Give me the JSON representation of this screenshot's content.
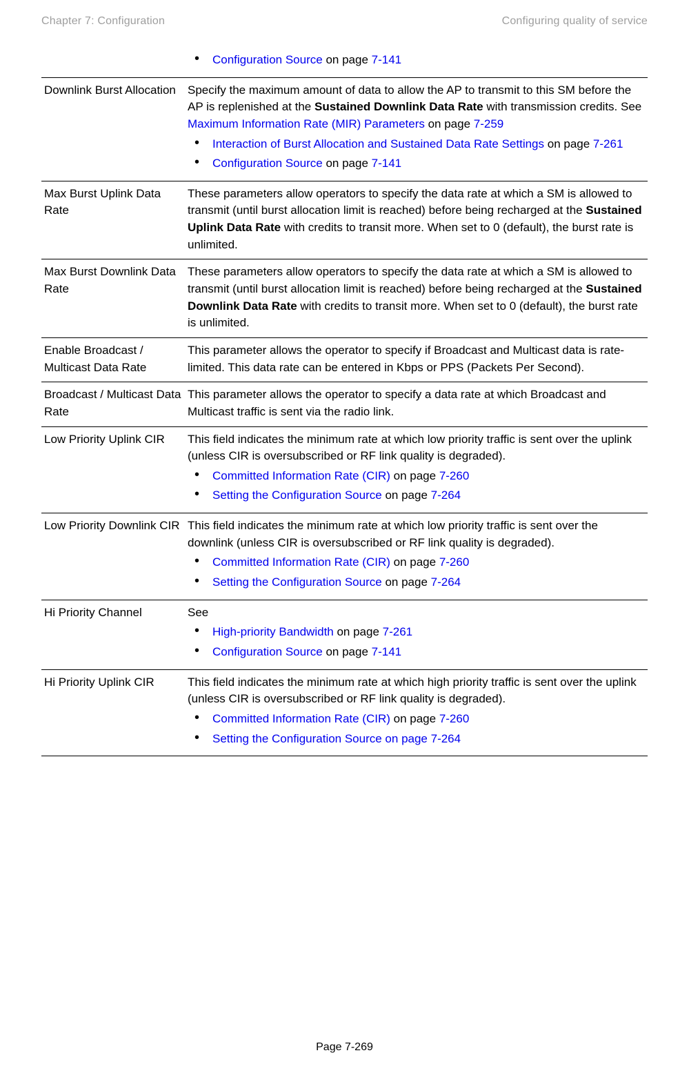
{
  "header": {
    "left": "Chapter 7:  Configuration",
    "right": "Configuring quality of service"
  },
  "footer": {
    "page": "Page 7-269"
  },
  "row0": {
    "b1_link": "Configuration Source",
    "b1_mid": " on page ",
    "b1_page": "7-141"
  },
  "row1": {
    "attr": "Downlink Burst Allocation",
    "p1a": "Specify the maximum amount of data to allow the AP to transmit to this SM before the AP is replenished at the ",
    "p1bold": "Sustained Downlink Data Rate",
    "p1b": " with transmission credits. See ",
    "p1link": "Maximum Information Rate (MIR) Parameters",
    "p1c": " on page ",
    "p1page": "7-259",
    "b1_link": "Interaction of Burst Allocation and Sustained Data Rate Settings",
    "b1_mid": " on page ",
    "b1_page": "7-261",
    "b2_link": "Configuration Source",
    "b2_mid": " on page ",
    "b2_page": "7-141"
  },
  "row2": {
    "attr": "Max Burst Uplink Data Rate",
    "p_a": "These parameters allow operators to specify the data rate at which a SM is allowed to transmit (until burst allocation limit is reached) before being recharged at the ",
    "p_bold": "Sustained Uplink Data Rate",
    "p_b": " with credits to transit more. When set to 0 (default), the burst rate is unlimited."
  },
  "row3": {
    "attr": "Max Burst Downlink Data Rate",
    "p_a": "These parameters allow operators to specify the data rate at which a SM is allowed to transmit (until burst allocation limit is reached) before being recharged at the ",
    "p_bold": "Sustained Downlink Data Rate",
    "p_b": " with credits to transit more. When set to 0 (default), the burst rate is unlimited."
  },
  "row4": {
    "attr": "Enable Broadcast / Multicast Data Rate",
    "p": "This parameter allows the operator to specify if Broadcast and Multicast data is rate-limited. This data rate can be entered in Kbps or PPS (Packets Per Second)."
  },
  "row5": {
    "attr": "Broadcast / Multicast Data Rate",
    "p": "This parameter allows the operator to specify a data rate at which Broadcast and Multicast traffic is sent via the radio link."
  },
  "row6": {
    "attr": "Low Priority Uplink CIR",
    "p": "This field indicates the minimum rate at which low priority traffic is sent over the uplink (unless CIR is oversubscribed or RF link quality is degraded).",
    "b1_sp": " ",
    "b1_link": "Committed Information Rate (CIR)",
    "b1_mid": " on page ",
    "b1_page": "7-260",
    "b2_link": "Setting the Configuration Source",
    "b2_mid": " on page ",
    "b2_page": "7-264"
  },
  "row7": {
    "attr": "Low Priority Downlink CIR",
    "p": "This field indicates the minimum rate at which low priority traffic is sent over the downlink (unless CIR is oversubscribed or RF link quality is degraded).",
    "b1_link": "Committed Information Rate (CIR)",
    "b1_mid": " on page ",
    "b1_page": "7-260",
    "b2_link": "Setting the Configuration Source",
    "b2_mid": " on page ",
    "b2_page": "7-264"
  },
  "row8": {
    "attr": "Hi Priority Channel",
    "p": "See",
    "b1_link": "High-priority Bandwidth",
    "b1_mid": " on page ",
    "b1_page": "7-261",
    "b2_link": "Configuration Source",
    "b2_mid": " on page ",
    "b2_page": "7-141"
  },
  "row9": {
    "attr": "Hi Priority Uplink CIR",
    "p": "This field indicates the minimum rate at which high priority traffic is sent over the uplink (unless CIR is oversubscribed or RF link quality is degraded).",
    "b1_link": "Committed Information Rate (CIR)",
    "b1_mid": " on page ",
    "b1_page": "7-260",
    "b2_link": "Setting the Configuration Source on page 7-264"
  }
}
